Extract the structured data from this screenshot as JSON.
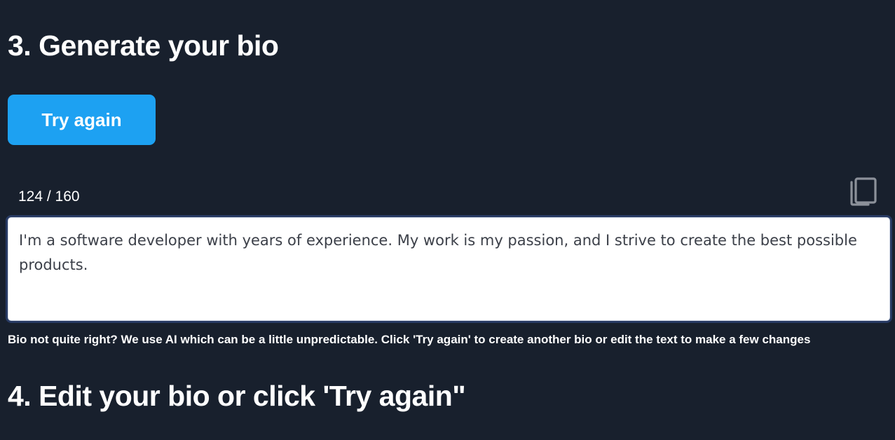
{
  "section3": {
    "heading": "3. Generate your bio",
    "try_again_label": "Try again"
  },
  "bio": {
    "counter": "124 / 160",
    "text": "I'm a software developer with years of experience. My work is my passion, and I strive to create the best possible products.",
    "copy_icon": "copy-icon",
    "helper": "Bio not quite right? We use AI which can be a little unpredictable. Click 'Try again' to create another bio or edit the text to make a few changes"
  },
  "section4": {
    "heading": "4. Edit your bio or click 'Try again\""
  },
  "colors": {
    "background": "#18202d",
    "accent": "#1da1f2",
    "text": "#ffffff",
    "textarea_text": "#3c4049",
    "icon": "#8c919a"
  }
}
